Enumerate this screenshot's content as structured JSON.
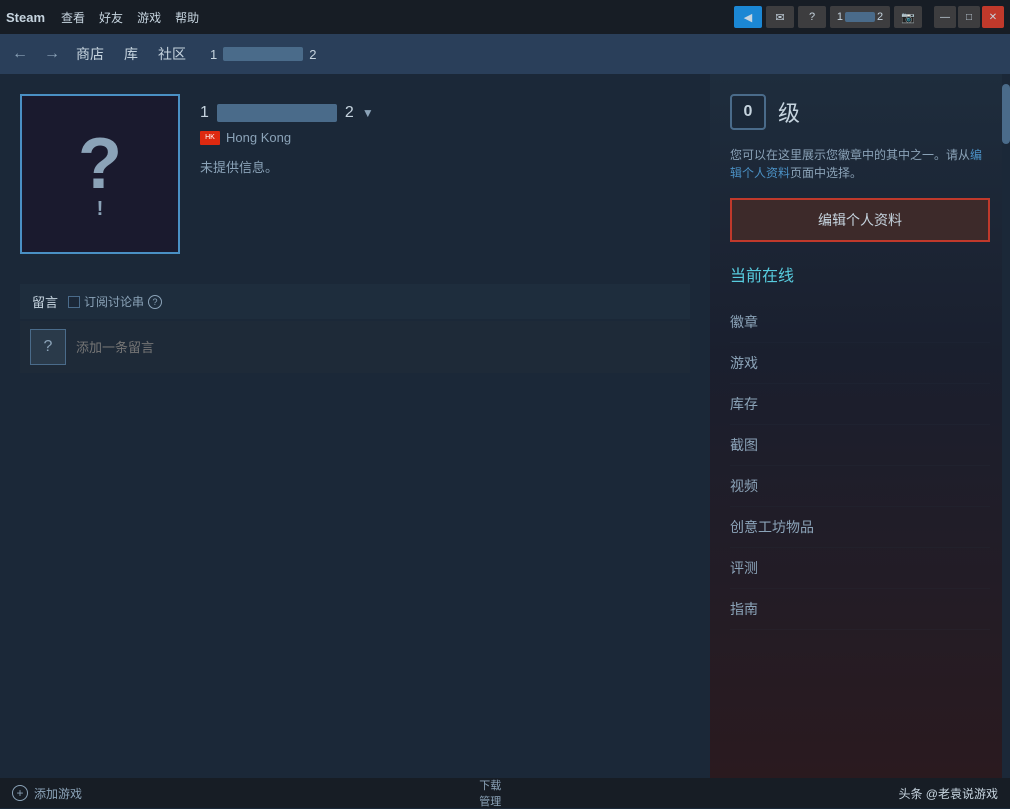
{
  "titleBar": {
    "appName": "Steam",
    "menuItems": [
      "查看",
      "好友",
      "游戏",
      "帮助"
    ],
    "icons": {
      "broadcast": "📡",
      "friends": "✉",
      "help": "?",
      "userLevel": "1",
      "userSuffix": "2",
      "screenshot": "📷"
    },
    "windowControls": {
      "minimize": "—",
      "maximize": "□",
      "close": "✕"
    }
  },
  "navBar": {
    "backArrow": "←",
    "forwardArrow": "→",
    "links": [
      "商店",
      "库",
      "社区"
    ],
    "usernamePrefix": "1",
    "usernameSuffix": "2"
  },
  "profile": {
    "usernamePrefix": "1",
    "usernameSuffix": "2",
    "country": "Hong Kong",
    "bio": "未提供信息。",
    "avatarQuestion": "?",
    "avatarExclamation": "!"
  },
  "rightPanel": {
    "levelBadge": "0",
    "levelLabel": "级",
    "badgeInfo": "您可以在这里展示您徽章中的其中之一。请从编辑个人资料页面中选择。",
    "editProfileBtn": "编辑个人资料",
    "onlineStatus": "当前在线",
    "navItems": [
      "徽章",
      "游戏",
      "库存",
      "截图",
      "视频",
      "创意工坊物品",
      "评测",
      "指南"
    ]
  },
  "commentSection": {
    "title": "留言",
    "subscribeLabel": "订阅讨论串",
    "helpTooltip": "?",
    "inputPlaceholder": "添加一条留言"
  },
  "bottomBar": {
    "addGame": "添加游戏",
    "downloadLabel": "下载",
    "downloadSubLabel": "管理",
    "watermark": "头条 @老袁说游戏"
  }
}
